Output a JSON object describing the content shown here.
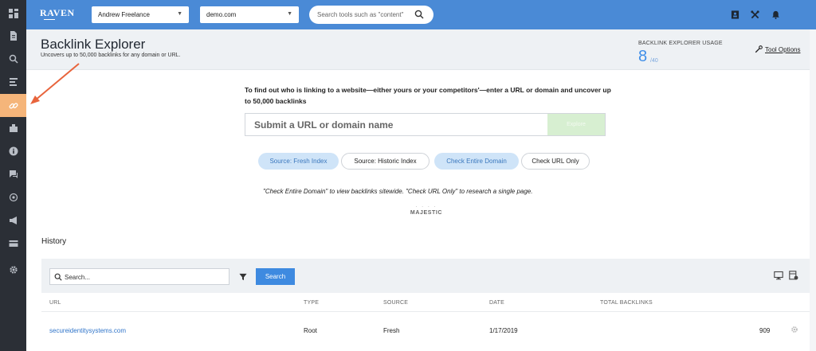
{
  "brand": {
    "logo_text": "RAVEN"
  },
  "topbar": {
    "account_select": "Andrew Freelance",
    "domain_select": "demo.com",
    "search_placeholder": "Search tools such as \"content\""
  },
  "header": {
    "title": "Backlink Explorer",
    "subtitle": "Uncovers up to 50,000 backlinks for any domain or URL.",
    "usage_label": "BACKLINK EXPLORER USAGE",
    "usage_count": "8",
    "usage_total": "/40",
    "tool_options": "Tool Options"
  },
  "main": {
    "intro": "To find out who is linking to a website—either yours or your competitors'—enter a URL or domain and uncover up to 50,000 backlinks",
    "url_placeholder": "Submit a URL or domain name",
    "explore_label": "Explore",
    "source_fresh": "Source: Fresh Index",
    "source_historic": "Source: Historic Index",
    "check_domain": "Check Entire Domain",
    "check_url": "Check URL Only",
    "hint": "\"Check Entire Domain\" to view backlinks sitewide. \"Check URL Only\" to research a single page.",
    "provider": "MAJESTIC"
  },
  "history": {
    "title": "History",
    "search_placeholder": "Search...",
    "search_button": "Search",
    "columns": [
      "URL",
      "TYPE",
      "SOURCE",
      "DATE",
      "TOTAL BACKLINKS"
    ],
    "rows": [
      {
        "url": "secureidentitysystems.com",
        "type": "Root",
        "source": "Fresh",
        "date": "1/17/2019",
        "total": "909"
      }
    ]
  },
  "colors": {
    "topbar": "#4a8ad6",
    "sidebar": "#2b2f36",
    "sidebar_active": "#f5b57a",
    "accent": "#3e8ae0",
    "annotation_arrow": "#e8643c"
  },
  "icons": {
    "sidebar": [
      "dashboard-icon",
      "document-icon",
      "search-icon",
      "report-icon",
      "link-icon",
      "building-icon",
      "info-icon",
      "chat-icon",
      "target-icon",
      "megaphone-icon",
      "card-icon",
      "gear-icon"
    ],
    "topbar": [
      "contact-card-icon",
      "tools-icon",
      "bell-icon"
    ]
  }
}
